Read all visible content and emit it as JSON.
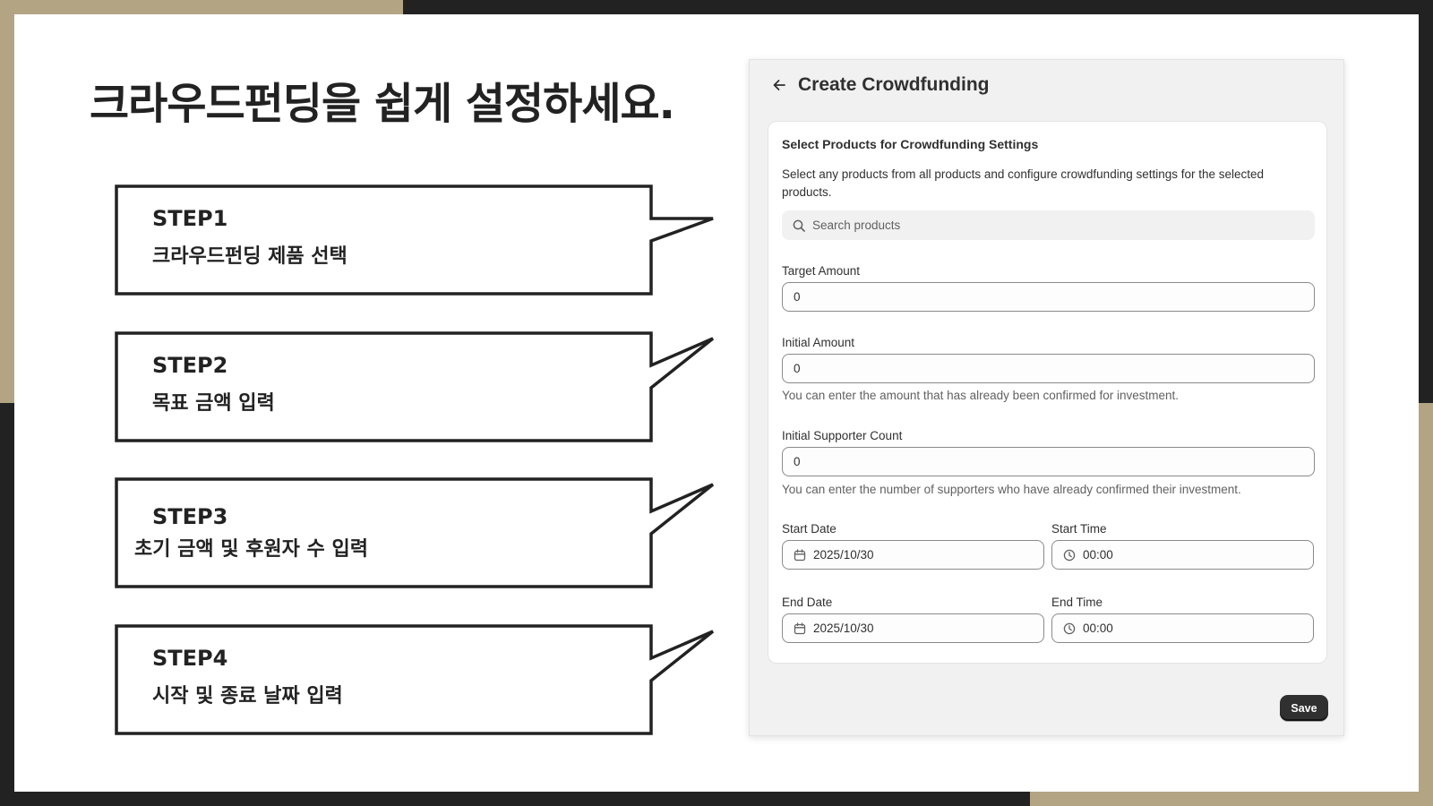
{
  "headline": "크라우드펀딩을 쉽게 설정하세요.",
  "steps": [
    {
      "title": "STEP1",
      "desc": "크라우드펀딩 제품 선택"
    },
    {
      "title": "STEP2",
      "desc": "목표 금액 입력"
    },
    {
      "title": "STEP3",
      "desc": "초기 금액 및 후원자 수 입력"
    },
    {
      "title": "STEP4",
      "desc": "시작 및 종료 날짜 입력"
    }
  ],
  "panel": {
    "title": "Create Crowdfunding",
    "back_icon": "arrow-left-icon",
    "save_label": "Save"
  },
  "card": {
    "title": "Select Products for Crowdfunding Settings",
    "description": "Select any products from all products and configure crowdfunding settings for the selected products.",
    "search_placeholder": "Search products",
    "target_amount": {
      "label": "Target Amount",
      "value": "0"
    },
    "initial_amount": {
      "label": "Initial Amount",
      "value": "0",
      "help": "You can enter the amount that has already been confirmed for investment."
    },
    "initial_supporter_count": {
      "label": "Initial Supporter Count",
      "value": "0",
      "help": "You can enter the number of supporters who have already confirmed their investment."
    },
    "start_date": {
      "label": "Start Date",
      "value": "2025/10/30"
    },
    "start_time": {
      "label": "Start Time",
      "value": "00:00"
    },
    "end_date": {
      "label": "End Date",
      "value": "2025/10/30"
    },
    "end_time": {
      "label": "End Time",
      "value": "00:00"
    }
  },
  "colors": {
    "accent_gold": "#b3a583",
    "frame_dark": "#222222",
    "button_dark": "#303030"
  }
}
